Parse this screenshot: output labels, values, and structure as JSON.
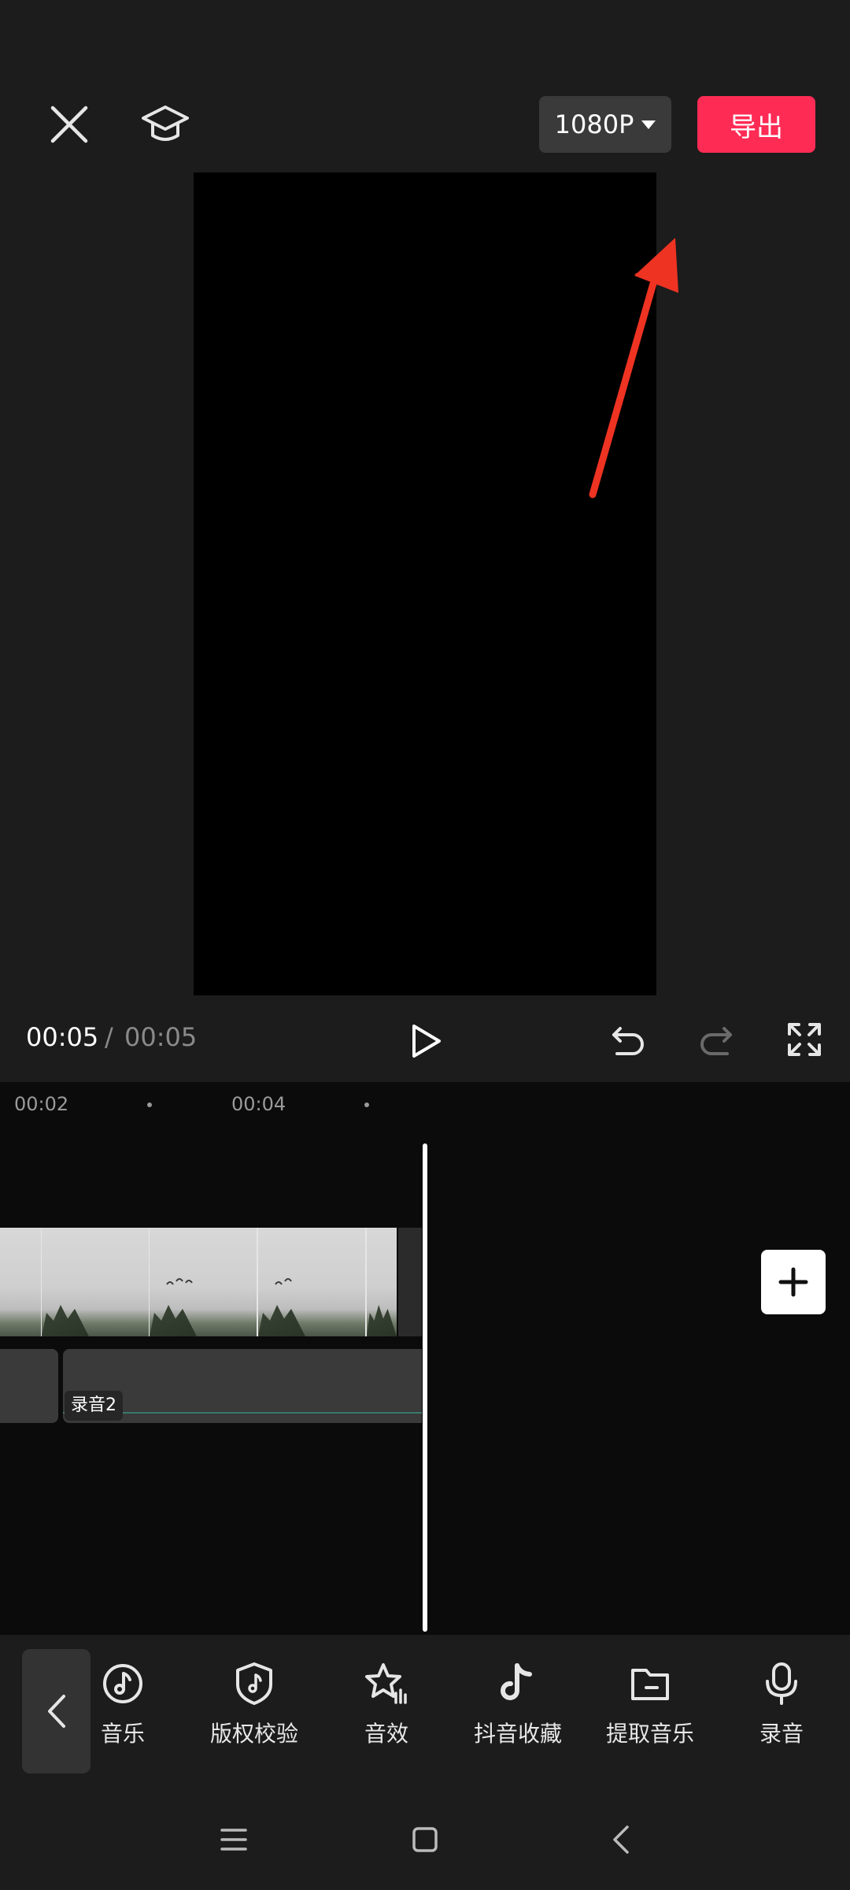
{
  "header": {
    "resolution_label": "1080P",
    "export_label": "导出"
  },
  "playback": {
    "current_time": "00:05",
    "separator": "/",
    "total_time": "00:05"
  },
  "timeline": {
    "ruler": [
      "00:02",
      "00:04"
    ],
    "audio_clip_label": "录音2"
  },
  "toolbar": {
    "items": [
      {
        "label": "音乐",
        "icon": "music-note-icon"
      },
      {
        "label": "版权校验",
        "icon": "copyright-shield-icon"
      },
      {
        "label": "音效",
        "icon": "sound-effect-star-icon"
      },
      {
        "label": "抖音收藏",
        "icon": "douyin-logo-icon"
      },
      {
        "label": "提取音乐",
        "icon": "folder-extract-icon"
      },
      {
        "label": "录音",
        "icon": "microphone-icon"
      }
    ]
  },
  "colors": {
    "accent": "#fe2c55",
    "background": "#1c1c1c",
    "timeline_bg": "#0b0b0b",
    "annotation_arrow": "#ee3322"
  }
}
